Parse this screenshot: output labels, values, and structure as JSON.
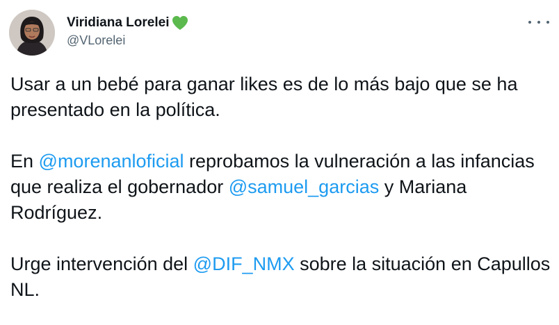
{
  "author": {
    "display_name": "Viridiana Lorelei",
    "handle": "@VLorelei",
    "badge_icon": "green-heart-icon",
    "badge_color": "#5bb94d"
  },
  "menu": {
    "icon": "more-horizontal-icon"
  },
  "tweet": {
    "p1": "Usar a un bebé para ganar likes es de lo más bajo que se ha presentado en la política.",
    "p2": {
      "t1": "En ",
      "m1": "@morenanloficial",
      "t2": " reprobamos la vulneración a las infancias que realiza el gobernador ",
      "m2": "@samuel_garcias",
      "t3": " y Mariana Rodríguez."
    },
    "p3": {
      "t1": "Urge intervención del ",
      "m1": "@DIF_NMX",
      "t2": " sobre la situación en Capullos NL."
    }
  },
  "colors": {
    "text": "#0f1419",
    "secondary": "#536471",
    "link": "#1d9bf0"
  }
}
